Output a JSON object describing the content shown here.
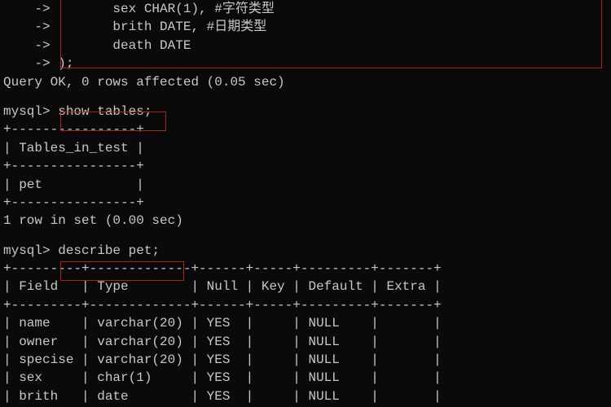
{
  "create_block": {
    "arrow": "    ->",
    "lines": [
      "        sex CHAR(1), #字符类型",
      "        brith DATE, #日期类型",
      "        death DATE"
    ],
    "closing": ");"
  },
  "query_ok": "Query OK, 0 rows affected (0.05 sec)",
  "prompt": "mysql>",
  "cmd_show_tables": "show tables;",
  "tables_border_top": "+----------------+",
  "tables_header": "| Tables_in_test |",
  "tables_border_mid": "+----------------+",
  "tables_row": "| pet            |",
  "tables_border_bot": "+----------------+",
  "row_in_set": "1 row in set (0.00 sec)",
  "cmd_describe": "describe pet;",
  "desc_border": "+---------+-------------+------+-----+---------+-------+",
  "desc_header": "| Field   | Type        | Null | Key | Default | Extra |",
  "desc_rows": [
    "| name    | varchar(20) | YES  |     | NULL    |       |",
    "| owner   | varchar(20) | YES  |     | NULL    |       |",
    "| specise | varchar(20) | YES  |     | NULL    |       |",
    "| sex     | char(1)     | YES  |     | NULL    |       |",
    "| brith   | date        | YES  |     | NULL    |       |"
  ]
}
